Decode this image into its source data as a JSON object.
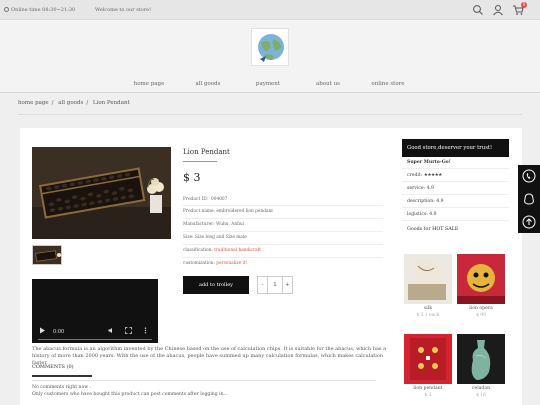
{
  "topbar": {
    "online_time": "Online time 08:30~21:30",
    "welcome": "Welcome to our store!",
    "cart_count": "0",
    "icons": [
      "clock-icon",
      "search-icon",
      "user-icon",
      "cart-icon"
    ]
  },
  "nav": {
    "items": [
      "home page",
      "all goods",
      "payment",
      "about us",
      "online store"
    ]
  },
  "breadcrumb": [
    "home page",
    "all goods",
    "Lion Pendant"
  ],
  "product": {
    "name": "Lion Pendant",
    "price": "$ 3",
    "attributes": [
      {
        "label": "Product ID：",
        "value": "004007",
        "highlight": false
      },
      {
        "label": "Product name: ",
        "value": "embroidered lion pendant",
        "highlight": false
      },
      {
        "label": "Manufacturer: ",
        "value": "Wuhu, Anhui",
        "highlight": false
      },
      {
        "label": "Size: ",
        "value": "Size long and Size male",
        "highlight": false
      },
      {
        "label": "classification: ",
        "value": "traditional handicraft",
        "highlight": true
      },
      {
        "label": "customization: ",
        "value": "personalize it!",
        "highlight": true
      }
    ],
    "add_to_trolley": "add to trolley",
    "qty_minus": "-",
    "qty_value": "1",
    "qty_plus": "+"
  },
  "video": {
    "time": "0:00"
  },
  "description": "The abacus formula is an algorithm invented by the Chinese based on the use of calculation chips. It is suitable for the abacus, which has a history of more than 2000 years. With the use of the abacus, people have summed up many calculation formulas, which makes calculation faster.",
  "comments": {
    "tab_label": "COMMENTS (0)",
    "empty_line1": "No comments right now .",
    "empty_line2": "Only customers who have bought this product can post comments after logging in..."
  },
  "store": {
    "header": "Good store,deserver your trust!",
    "name": "Super Murto-Go!",
    "rows": [
      {
        "label": "credit:",
        "value": "★★★★★"
      },
      {
        "label": "service:",
        "value": "4.9"
      },
      {
        "label": "description:",
        "value": "4.9"
      },
      {
        "label": "logistics:",
        "value": "4.9"
      }
    ],
    "goods_title": "Goods for ",
    "goods_title_hl": "HOT SALE",
    "goods": [
      {
        "name": "silk",
        "price": "$ 3.1 each"
      },
      {
        "name": "lion opera",
        "price": "$ 99"
      },
      {
        "name": "lion pendant",
        "price": "$ 3"
      },
      {
        "name": "celadon",
        "price": "$ 16"
      }
    ]
  },
  "colors": {
    "accent": "#111111",
    "highlight": "#d9534f",
    "badge": "#e64a4a"
  }
}
